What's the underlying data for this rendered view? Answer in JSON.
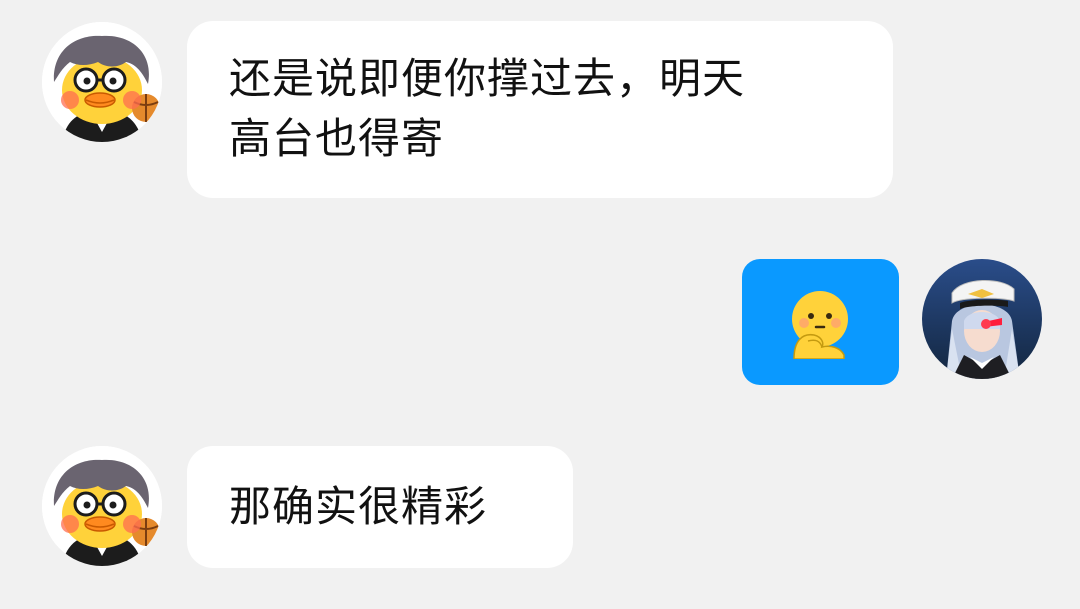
{
  "colors": {
    "background": "#f1f1f1",
    "incoming_bubble": "#ffffff",
    "outgoing_bubble": "#0a99ff",
    "text": "#111111"
  },
  "messages": [
    {
      "side": "left",
      "avatar": "duck-avatar-icon",
      "text": "还是说即便你撑过去，明天\n高台也得寄"
    },
    {
      "side": "right",
      "avatar": "anime-officer-avatar-icon",
      "emoji": "thinking-emoji-icon"
    },
    {
      "side": "left",
      "avatar": "duck-avatar-icon",
      "text": "那确实很精彩"
    }
  ]
}
